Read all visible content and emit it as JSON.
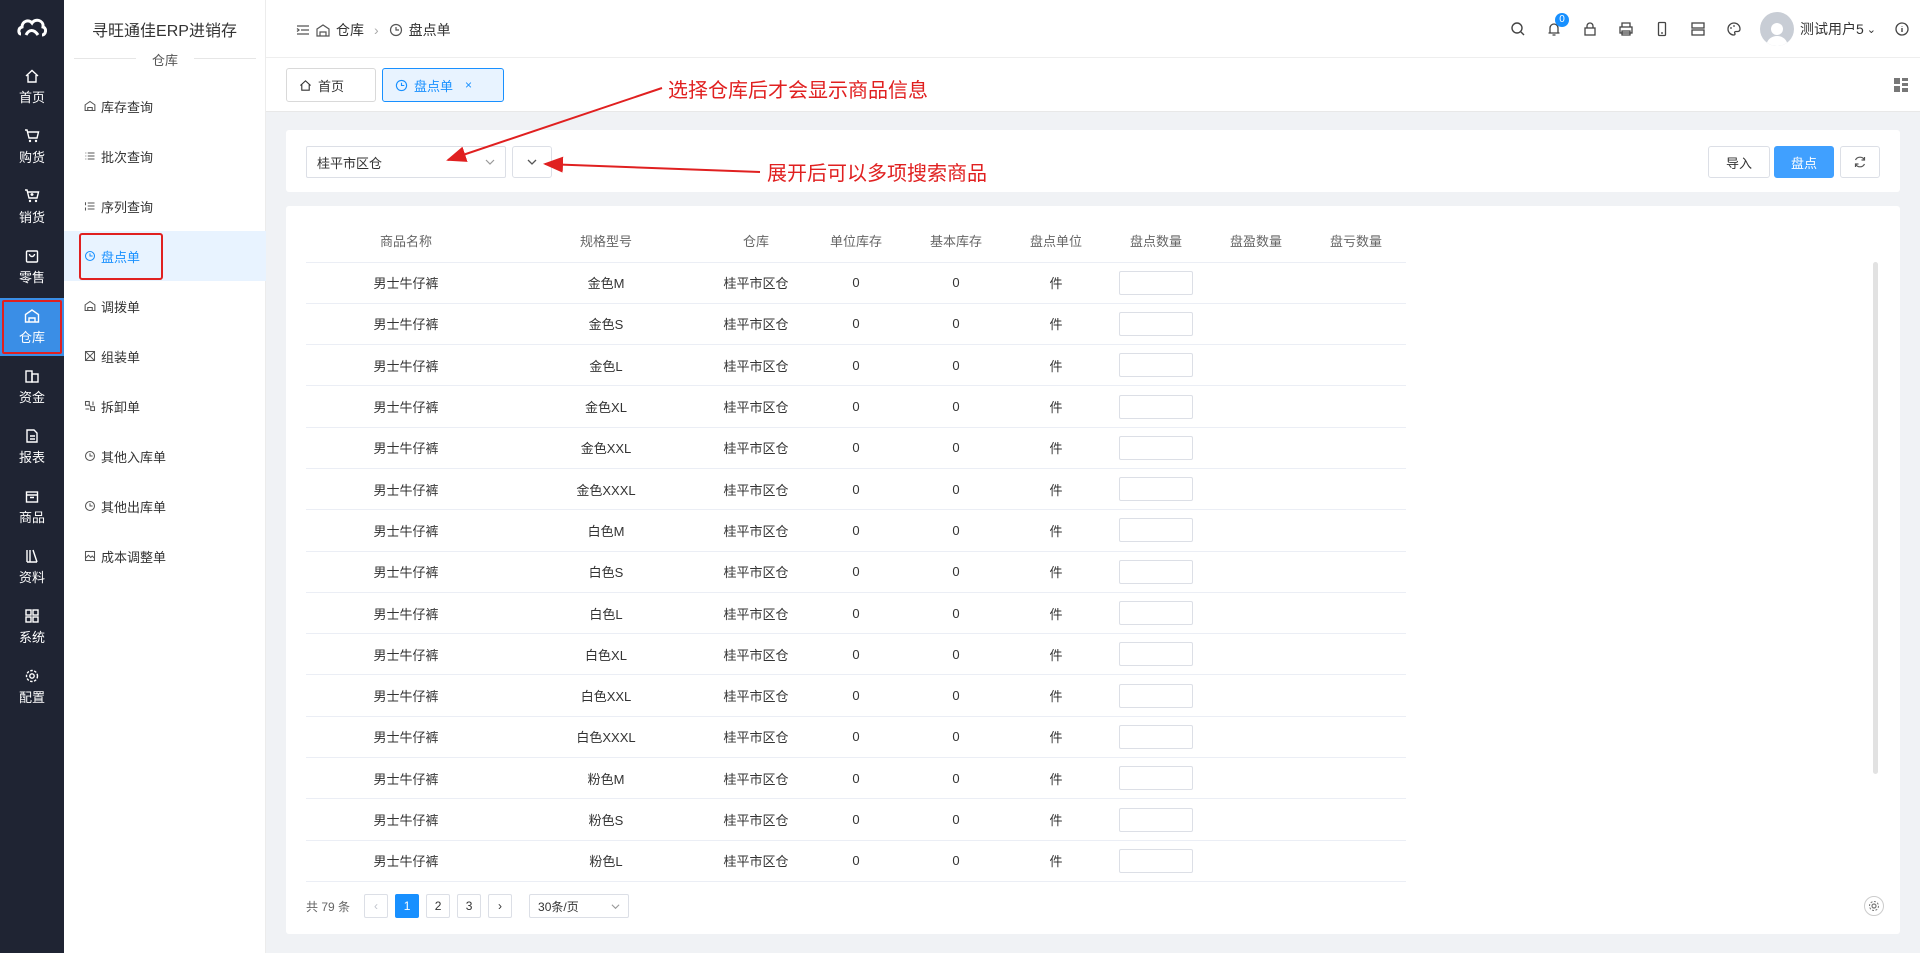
{
  "app": {
    "title": "寻旺通佳ERP进销存",
    "section": "仓库"
  },
  "rail": {
    "items": [
      {
        "label": "首页",
        "icon": "home-icon"
      },
      {
        "label": "购货",
        "icon": "cart-icon"
      },
      {
        "label": "销货",
        "icon": "sell-cart-icon"
      },
      {
        "label": "零售",
        "icon": "bag-icon"
      },
      {
        "label": "仓库",
        "icon": "warehouse-icon",
        "active": true
      },
      {
        "label": "资金",
        "icon": "coins-icon"
      },
      {
        "label": "报表",
        "icon": "report-icon"
      },
      {
        "label": "商品",
        "icon": "box-icon"
      },
      {
        "label": "资料",
        "icon": "books-icon"
      },
      {
        "label": "系统",
        "icon": "grid-icon"
      },
      {
        "label": "配置",
        "icon": "gear-icon"
      }
    ]
  },
  "submenu": {
    "items": [
      {
        "label": "库存查询",
        "icon": "warehouse-icon"
      },
      {
        "label": "批次查询",
        "icon": "list-icon"
      },
      {
        "label": "序列查询",
        "icon": "ordered-list-icon"
      },
      {
        "label": "盘点单",
        "icon": "clock-icon",
        "active": true
      },
      {
        "label": "调拨单",
        "icon": "warehouse-icon"
      },
      {
        "label": "组装单",
        "icon": "assemble-icon"
      },
      {
        "label": "拆卸单",
        "icon": "disassemble-icon"
      },
      {
        "label": "其他入库单",
        "icon": "clock-icon"
      },
      {
        "label": "其他出库单",
        "icon": "clock-icon"
      },
      {
        "label": "成本调整单",
        "icon": "image-icon"
      }
    ]
  },
  "breadcrumb": {
    "parent": "仓库",
    "current": "盘点单"
  },
  "header": {
    "notification_count": "0",
    "user_name": "测试用户5"
  },
  "tabs": [
    {
      "label": "首页"
    },
    {
      "label": "盘点单",
      "close": "×"
    }
  ],
  "filter": {
    "warehouse": "桂平市区仓",
    "import_label": "导入",
    "check_label": "盘点"
  },
  "table": {
    "columns": [
      "商品名称",
      "规格型号",
      "仓库",
      "单位库存",
      "基本库存",
      "盘点单位",
      "盘点数量",
      "盘盈数量",
      "盘亏数量"
    ],
    "rows": [
      [
        "男士牛仔裤",
        "金色M",
        "桂平市区仓",
        "0",
        "0",
        "件"
      ],
      [
        "男士牛仔裤",
        "金色S",
        "桂平市区仓",
        "0",
        "0",
        "件"
      ],
      [
        "男士牛仔裤",
        "金色L",
        "桂平市区仓",
        "0",
        "0",
        "件"
      ],
      [
        "男士牛仔裤",
        "金色XL",
        "桂平市区仓",
        "0",
        "0",
        "件"
      ],
      [
        "男士牛仔裤",
        "金色XXL",
        "桂平市区仓",
        "0",
        "0",
        "件"
      ],
      [
        "男士牛仔裤",
        "金色XXXL",
        "桂平市区仓",
        "0",
        "0",
        "件"
      ],
      [
        "男士牛仔裤",
        "白色M",
        "桂平市区仓",
        "0",
        "0",
        "件"
      ],
      [
        "男士牛仔裤",
        "白色S",
        "桂平市区仓",
        "0",
        "0",
        "件"
      ],
      [
        "男士牛仔裤",
        "白色L",
        "桂平市区仓",
        "0",
        "0",
        "件"
      ],
      [
        "男士牛仔裤",
        "白色XL",
        "桂平市区仓",
        "0",
        "0",
        "件"
      ],
      [
        "男士牛仔裤",
        "白色XXL",
        "桂平市区仓",
        "0",
        "0",
        "件"
      ],
      [
        "男士牛仔裤",
        "白色XXXL",
        "桂平市区仓",
        "0",
        "0",
        "件"
      ],
      [
        "男士牛仔裤",
        "粉色M",
        "桂平市区仓",
        "0",
        "0",
        "件"
      ],
      [
        "男士牛仔裤",
        "粉色S",
        "桂平市区仓",
        "0",
        "0",
        "件"
      ],
      [
        "男士牛仔裤",
        "粉色L",
        "桂平市区仓",
        "0",
        "0",
        "件"
      ]
    ]
  },
  "pagination": {
    "total": "共 79 条",
    "pages": [
      "1",
      "2",
      "3"
    ],
    "current": "1",
    "page_size": "30条/页"
  },
  "annotations": {
    "warehouse_note": "选择仓库后才会显示商品信息",
    "expand_note": "展开后可以多项搜索商品"
  },
  "colors": {
    "primary": "#1890ff",
    "rail_bg": "#1f2433",
    "annotation": "#e02020"
  }
}
